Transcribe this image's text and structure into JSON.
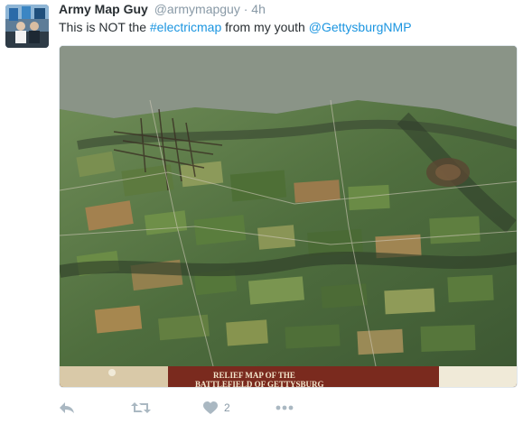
{
  "tweet": {
    "display_name": "Army Map Guy",
    "handle": "@armymapguy",
    "separator": "·",
    "time": "4h",
    "text_prefix": "This is NOT the ",
    "hashtag": "#electricmap",
    "text_middle": " from my youth ",
    "mention": "@GettysburgNMP",
    "media_caption_line1": "RELIEF MAP OF THE",
    "media_caption_line2": "BATTLEFIELD OF GETTYSBURG"
  },
  "actions": {
    "reply_icon": "reply-icon",
    "retweet_icon": "retweet-icon",
    "like_icon": "heart-icon",
    "like_count": "2",
    "more_icon": "more-icon"
  },
  "colors": {
    "link": "#1b95e0",
    "muted": "#8899a6",
    "text": "#292f33"
  }
}
